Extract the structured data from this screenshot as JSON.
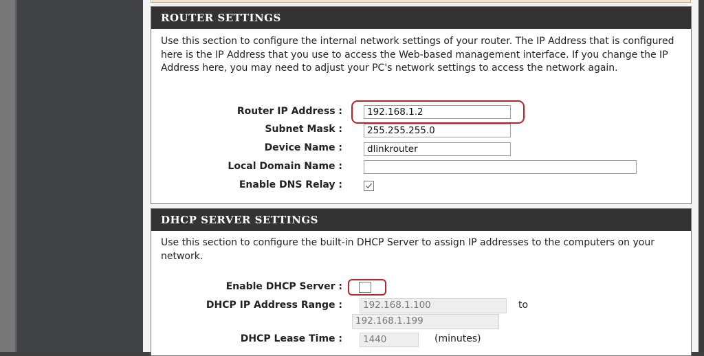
{
  "router_settings": {
    "title": "ROUTER SETTINGS",
    "description": "Use this section to configure the internal network settings of your router. The IP Address that is configured here is the IP Address that you use to access the Web-based management interface. If you change the IP Address here, you may need to adjust your PC's network settings to access the network again.",
    "fields": {
      "router_ip": {
        "label": "Router IP Address :",
        "value": "192.168.1.2"
      },
      "subnet_mask": {
        "label": "Subnet Mask :",
        "value": "255.255.255.0"
      },
      "device_name": {
        "label": "Device Name :",
        "value": "dlinkrouter"
      },
      "local_domain": {
        "label": "Local Domain Name :",
        "value": ""
      },
      "dns_relay": {
        "label": "Enable DNS Relay :",
        "checked": true
      }
    }
  },
  "dhcp_settings": {
    "title": "DHCP SERVER SETTINGS",
    "description": "Use this section to configure the built-in DHCP Server to assign IP addresses to the computers on your network.",
    "fields": {
      "enable_dhcp": {
        "label": "Enable DHCP Server :",
        "checked": false
      },
      "range": {
        "label": "DHCP IP Address Range :",
        "start": "192.168.1.100",
        "to_label": "to",
        "end": "192.168.1.199"
      },
      "lease_time": {
        "label": "DHCP Lease Time :",
        "value": "1440",
        "unit": "(minutes)"
      }
    }
  },
  "colors": {
    "header_bg": "#333333",
    "highlight": "#c0202a"
  }
}
